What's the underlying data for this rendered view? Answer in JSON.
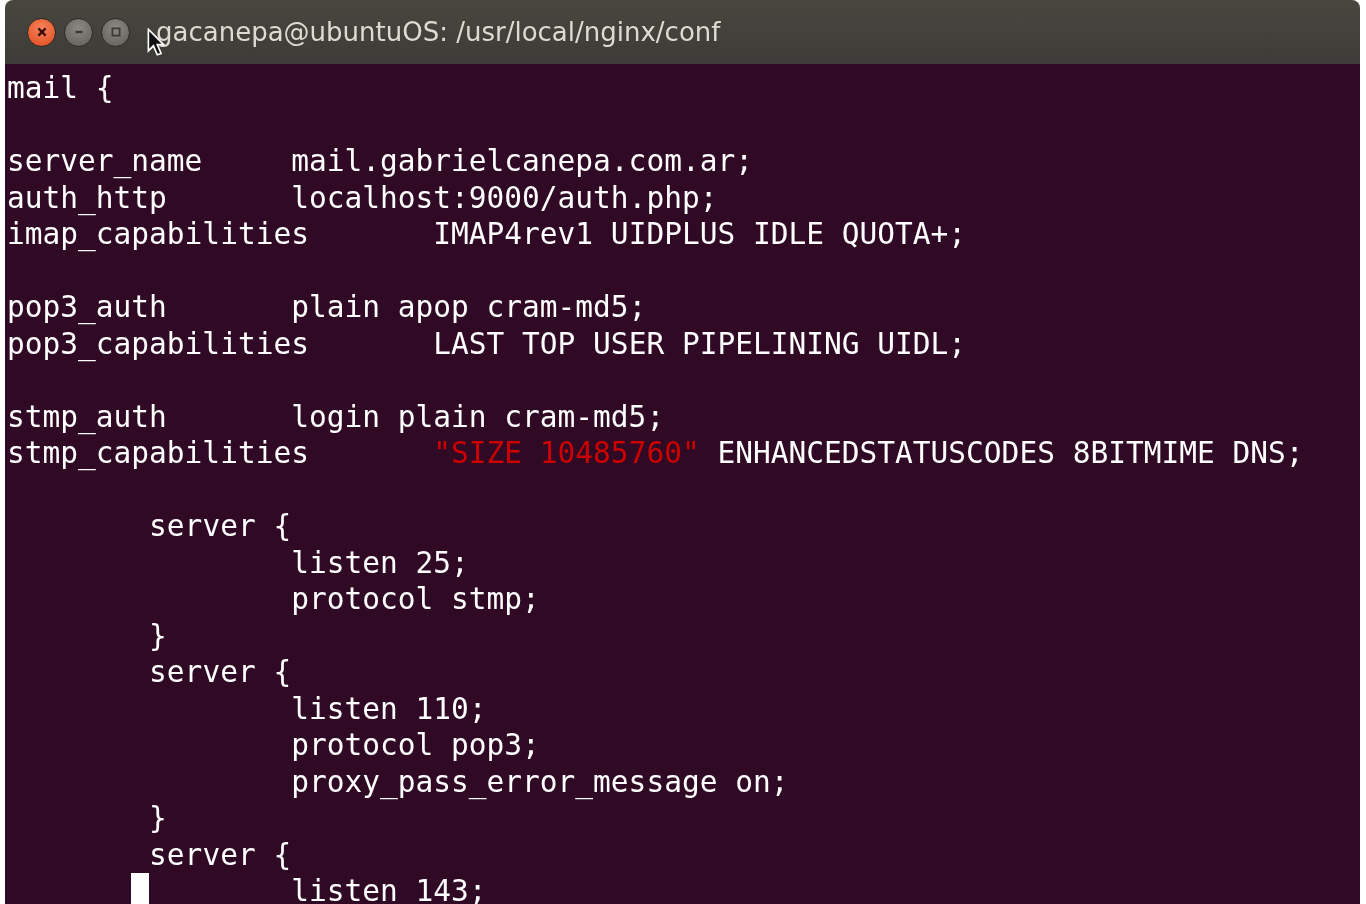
{
  "window": {
    "title": "gacanepa@ubuntuOS: /usr/local/nginx/conf"
  },
  "terminal": {
    "lines": [
      {
        "kind": "code",
        "segments": [
          {
            "kind": "text",
            "text": "mail {"
          }
        ]
      },
      {
        "kind": "blank"
      },
      {
        "kind": "code",
        "segments": [
          {
            "kind": "text",
            "text": "server_name\tmail.gabrielcanepa.com.ar;"
          }
        ]
      },
      {
        "kind": "code",
        "segments": [
          {
            "kind": "text",
            "text": "auth_http\tlocalhost:9000/auth.php;"
          }
        ]
      },
      {
        "kind": "code",
        "segments": [
          {
            "kind": "text",
            "text": "imap_capabilities\tIMAP4rev1 UIDPLUS IDLE QUOTA+;"
          }
        ]
      },
      {
        "kind": "blank"
      },
      {
        "kind": "code",
        "segments": [
          {
            "kind": "text",
            "text": "pop3_auth\tplain apop cram-md5;"
          }
        ]
      },
      {
        "kind": "code",
        "segments": [
          {
            "kind": "text",
            "text": "pop3_capabilities\tLAST TOP USER PIPELINING UIDL;"
          }
        ]
      },
      {
        "kind": "blank"
      },
      {
        "kind": "code",
        "segments": [
          {
            "kind": "text",
            "text": "stmp_auth\tlogin plain cram-md5;"
          }
        ]
      },
      {
        "kind": "code",
        "segments": [
          {
            "kind": "text",
            "text": "stmp_capabilities\t"
          },
          {
            "kind": "string",
            "text": "\"SIZE 10485760\""
          },
          {
            "kind": "text",
            "text": " ENHANCEDSTATUSCODES 8BITMIME DNS;"
          }
        ]
      },
      {
        "kind": "blank"
      },
      {
        "kind": "code",
        "segments": [
          {
            "kind": "text",
            "text": "\tserver {"
          }
        ]
      },
      {
        "kind": "code",
        "segments": [
          {
            "kind": "text",
            "text": "\t\tlisten 25;"
          }
        ]
      },
      {
        "kind": "code",
        "segments": [
          {
            "kind": "text",
            "text": "\t\tprotocol stmp;"
          }
        ]
      },
      {
        "kind": "code",
        "segments": [
          {
            "kind": "text",
            "text": "\t}"
          }
        ]
      },
      {
        "kind": "code",
        "segments": [
          {
            "kind": "text",
            "text": "\tserver {"
          }
        ]
      },
      {
        "kind": "code",
        "segments": [
          {
            "kind": "text",
            "text": "\t\tlisten 110;"
          }
        ]
      },
      {
        "kind": "code",
        "segments": [
          {
            "kind": "text",
            "text": "\t\tprotocol pop3;"
          }
        ]
      },
      {
        "kind": "code",
        "segments": [
          {
            "kind": "text",
            "text": "\t\tproxy_pass_error_message on;"
          }
        ]
      },
      {
        "kind": "code",
        "segments": [
          {
            "kind": "text",
            "text": "\t}"
          }
        ]
      },
      {
        "kind": "code",
        "segments": [
          {
            "kind": "text",
            "text": "\tserver {"
          }
        ]
      },
      {
        "kind": "code",
        "segments": [
          {
            "kind": "cursor"
          },
          {
            "kind": "text",
            "text": "\tlisten 143;"
          }
        ]
      }
    ]
  }
}
